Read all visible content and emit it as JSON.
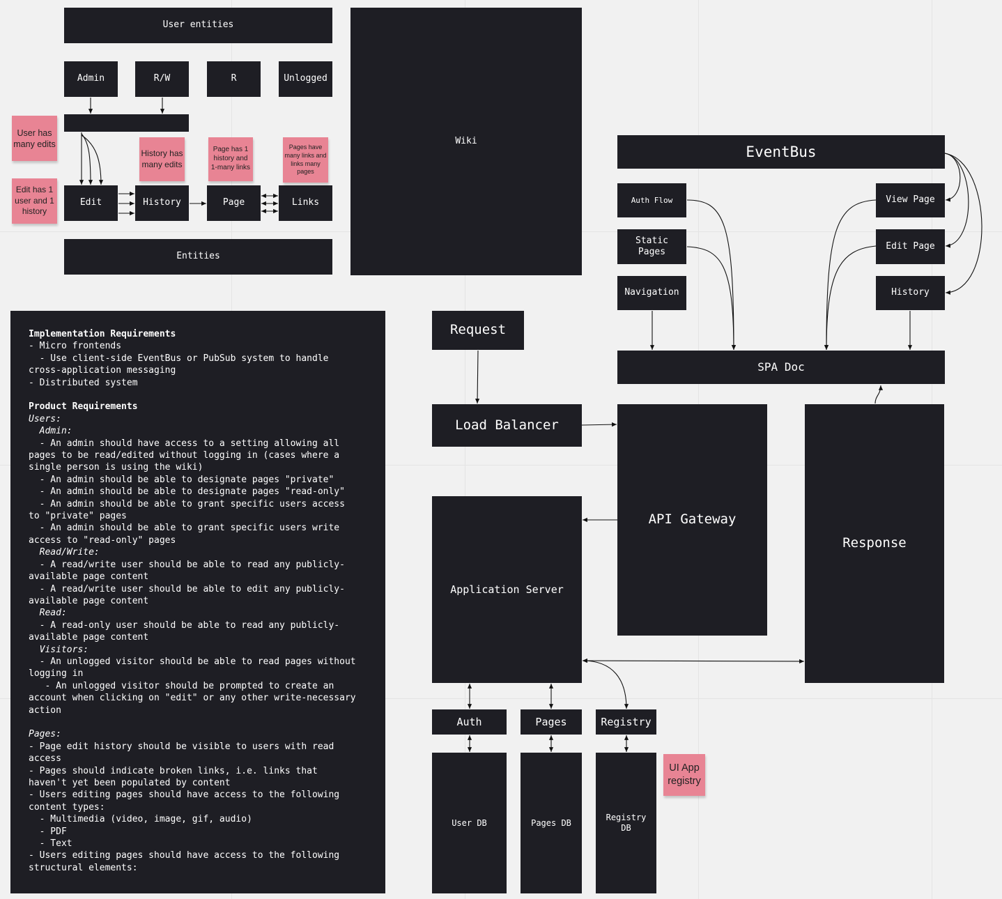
{
  "user_entities": {
    "title": "User entities",
    "roles": [
      "Admin",
      "R/W",
      "R",
      "Unlogged"
    ]
  },
  "entities": {
    "title": "Entities",
    "items": [
      "Edit",
      "History",
      "Page",
      "Links"
    ]
  },
  "stickies": {
    "user_has_many_edits": "User has many edits",
    "edit_has_user_history": "Edit has 1 user and 1 history",
    "history_has_many_edits": "History has many edits",
    "page_has_history_links": "Page has 1 history and 1-many links",
    "pages_have_many_links": "Pages have many links and links many pages",
    "ui_app_registry": "UI App registry"
  },
  "wiki": {
    "title": "Wiki"
  },
  "frontend": {
    "eventbus": "EventBus",
    "auth_flow": "Auth Flow",
    "static_pages": "Static Pages",
    "navigation": "Navigation",
    "view_page": "View Page",
    "edit_page": "Edit Page",
    "history": "History",
    "spa_doc": "SPA Doc"
  },
  "backend": {
    "request": "Request",
    "load_balancer": "Load Balancer",
    "api_gateway": "API Gateway",
    "application_server": "Application Server",
    "response": "Response",
    "auth": "Auth",
    "pages": "Pages",
    "registry": "Registry",
    "user_db": "User DB",
    "pages_db": "Pages DB",
    "registry_db": "Registry DB"
  },
  "notes": {
    "lines": [
      {
        "text": "Implementation Requirements",
        "style": "bold"
      },
      {
        "text": "- Micro frontends",
        "style": ""
      },
      {
        "text": "  - Use client-side EventBus or PubSub system to handle",
        "style": ""
      },
      {
        "text": "cross-application messaging",
        "style": ""
      },
      {
        "text": "- Distributed system",
        "style": ""
      },
      {
        "text": "",
        "style": ""
      },
      {
        "text": "Product Requirements",
        "style": "bold"
      },
      {
        "text": "Users:",
        "style": "italic"
      },
      {
        "text": "  Admin:",
        "style": "italic"
      },
      {
        "text": "  - An admin should have access to a setting allowing all",
        "style": ""
      },
      {
        "text": "pages to be read/edited without logging in (cases where a",
        "style": ""
      },
      {
        "text": "single person is using the wiki)",
        "style": ""
      },
      {
        "text": "  - An admin should be able to designate pages \"private\"",
        "style": ""
      },
      {
        "text": "  - An admin should be able to designate pages \"read-only\"",
        "style": ""
      },
      {
        "text": "  - An admin should be able to grant specific users access",
        "style": ""
      },
      {
        "text": "to \"private\" pages",
        "style": ""
      },
      {
        "text": "  - An admin should be able to grant specific users write",
        "style": ""
      },
      {
        "text": "access to \"read-only\" pages",
        "style": ""
      },
      {
        "text": "  Read/Write:",
        "style": "italic"
      },
      {
        "text": "  - A read/write user should be able to read any publicly-",
        "style": ""
      },
      {
        "text": "available page content",
        "style": ""
      },
      {
        "text": "  - A read/write user should be able to edit any publicly-",
        "style": ""
      },
      {
        "text": "available page content",
        "style": ""
      },
      {
        "text": "  Read:",
        "style": "italic"
      },
      {
        "text": "  - A read-only user should be able to read any publicly-",
        "style": ""
      },
      {
        "text": "available page content",
        "style": ""
      },
      {
        "text": "  Visitors:",
        "style": "italic"
      },
      {
        "text": "  - An unlogged visitor should be able to read pages without",
        "style": ""
      },
      {
        "text": "logging in",
        "style": ""
      },
      {
        "text": "   - An unlogged visitor should be prompted to create an",
        "style": ""
      },
      {
        "text": "account when clicking on \"edit\" or any other write-necessary",
        "style": ""
      },
      {
        "text": "action",
        "style": ""
      },
      {
        "text": "",
        "style": ""
      },
      {
        "text": "Pages:",
        "style": "italic"
      },
      {
        "text": "- Page edit history should be visible to users with read",
        "style": ""
      },
      {
        "text": "access",
        "style": ""
      },
      {
        "text": "- Pages should indicate broken links, i.e. links that",
        "style": ""
      },
      {
        "text": "haven't yet been populated by content",
        "style": ""
      },
      {
        "text": "- Users editing pages should have access to the following",
        "style": ""
      },
      {
        "text": "content types:",
        "style": ""
      },
      {
        "text": "  - Multimedia (video, image, gif, audio)",
        "style": ""
      },
      {
        "text": "  - PDF",
        "style": ""
      },
      {
        "text": "  - Text",
        "style": ""
      },
      {
        "text": "- Users editing pages should have access to the following",
        "style": ""
      },
      {
        "text": "structural elements:",
        "style": ""
      }
    ]
  },
  "colors": {
    "canvas": "#f1f1f1",
    "node": "#1e1e24",
    "node_text": "#ffffff",
    "sticky": "#e88494",
    "edge": "#111111"
  }
}
